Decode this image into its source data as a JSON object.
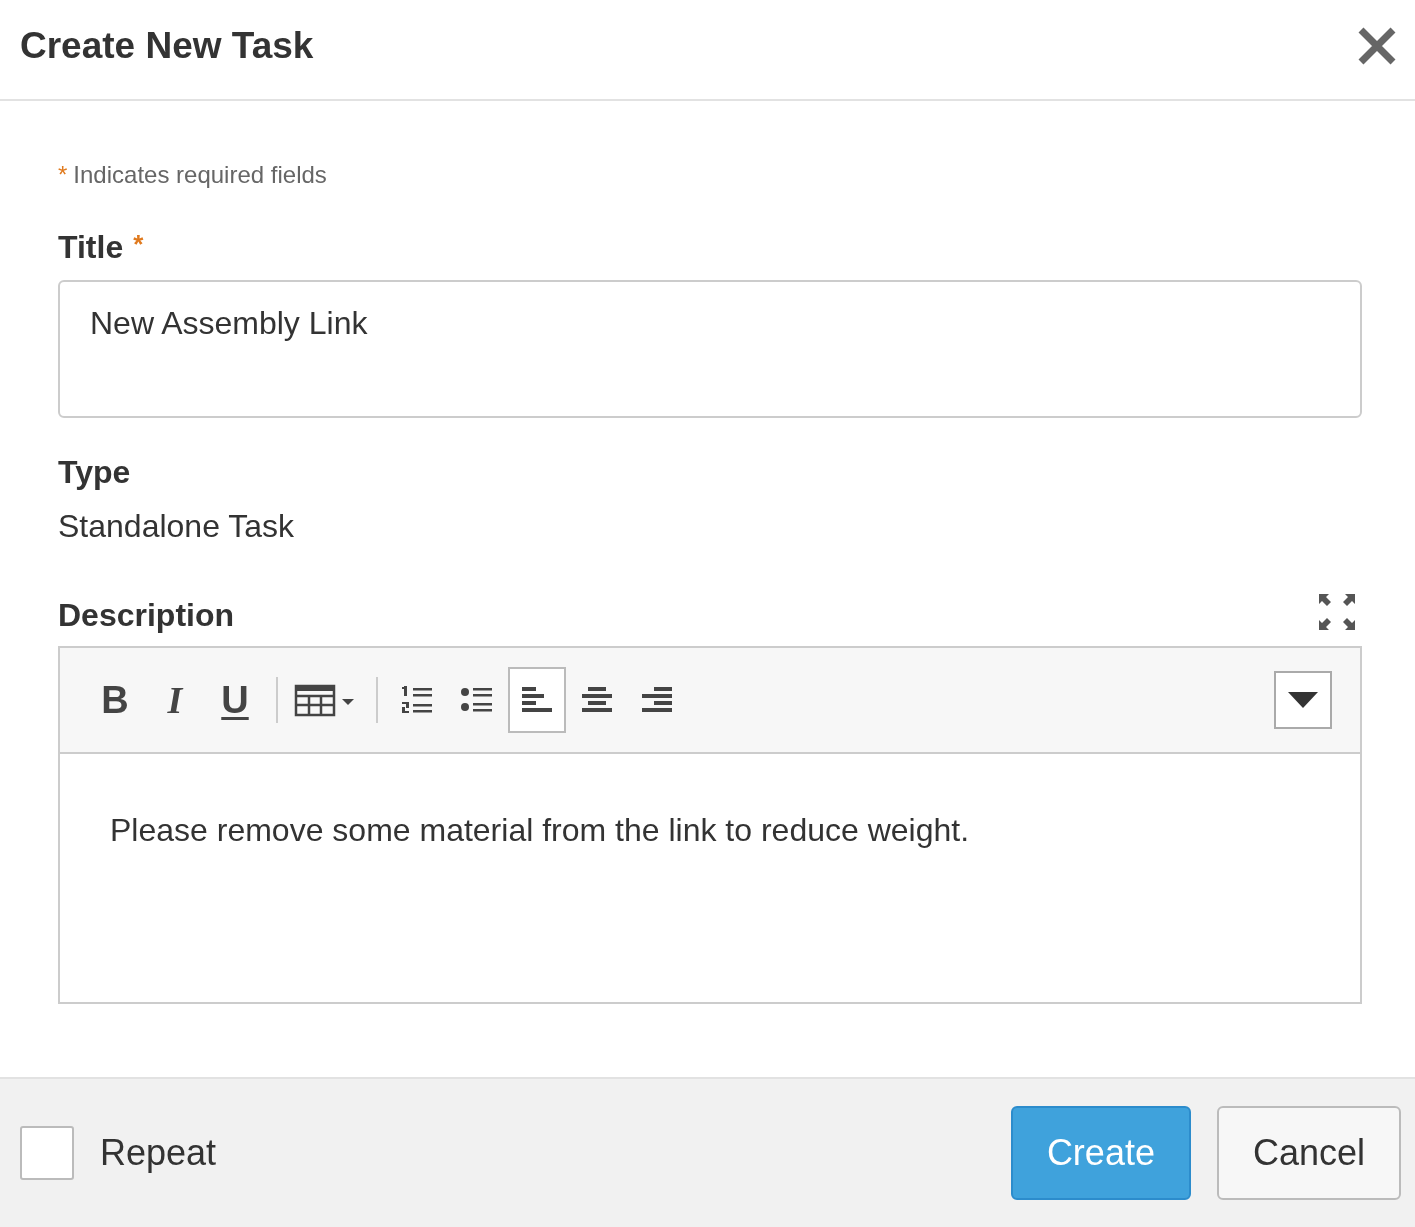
{
  "dialog": {
    "title": "Create New Task"
  },
  "required_note": {
    "mark": "*",
    "text": "Indicates required fields"
  },
  "title_field": {
    "label": "Title",
    "required_mark": "*",
    "value": "New Assembly Link"
  },
  "type_field": {
    "label": "Type",
    "value": "Standalone Task"
  },
  "description": {
    "label": "Description",
    "toolbar": [
      {
        "kind": "bold",
        "glyph": "B",
        "selected": false
      },
      {
        "kind": "italic",
        "glyph": "I",
        "selected": false
      },
      {
        "kind": "underline",
        "glyph": "U",
        "selected": false
      },
      {
        "kind": "separator"
      },
      {
        "kind": "table",
        "selected": false
      },
      {
        "kind": "separator"
      },
      {
        "kind": "ordered-list",
        "selected": false
      },
      {
        "kind": "bullet-list",
        "selected": false
      },
      {
        "kind": "align-left",
        "selected": true
      },
      {
        "kind": "align-center",
        "selected": false
      },
      {
        "kind": "align-right",
        "selected": false
      }
    ],
    "text": "Please remove some material from the link to reduce weight."
  },
  "footer": {
    "repeat": {
      "label": "Repeat",
      "checked": false
    },
    "buttons": [
      {
        "label": "Create",
        "kind": "primary"
      },
      {
        "label": "Cancel",
        "kind": "secondary"
      }
    ]
  }
}
